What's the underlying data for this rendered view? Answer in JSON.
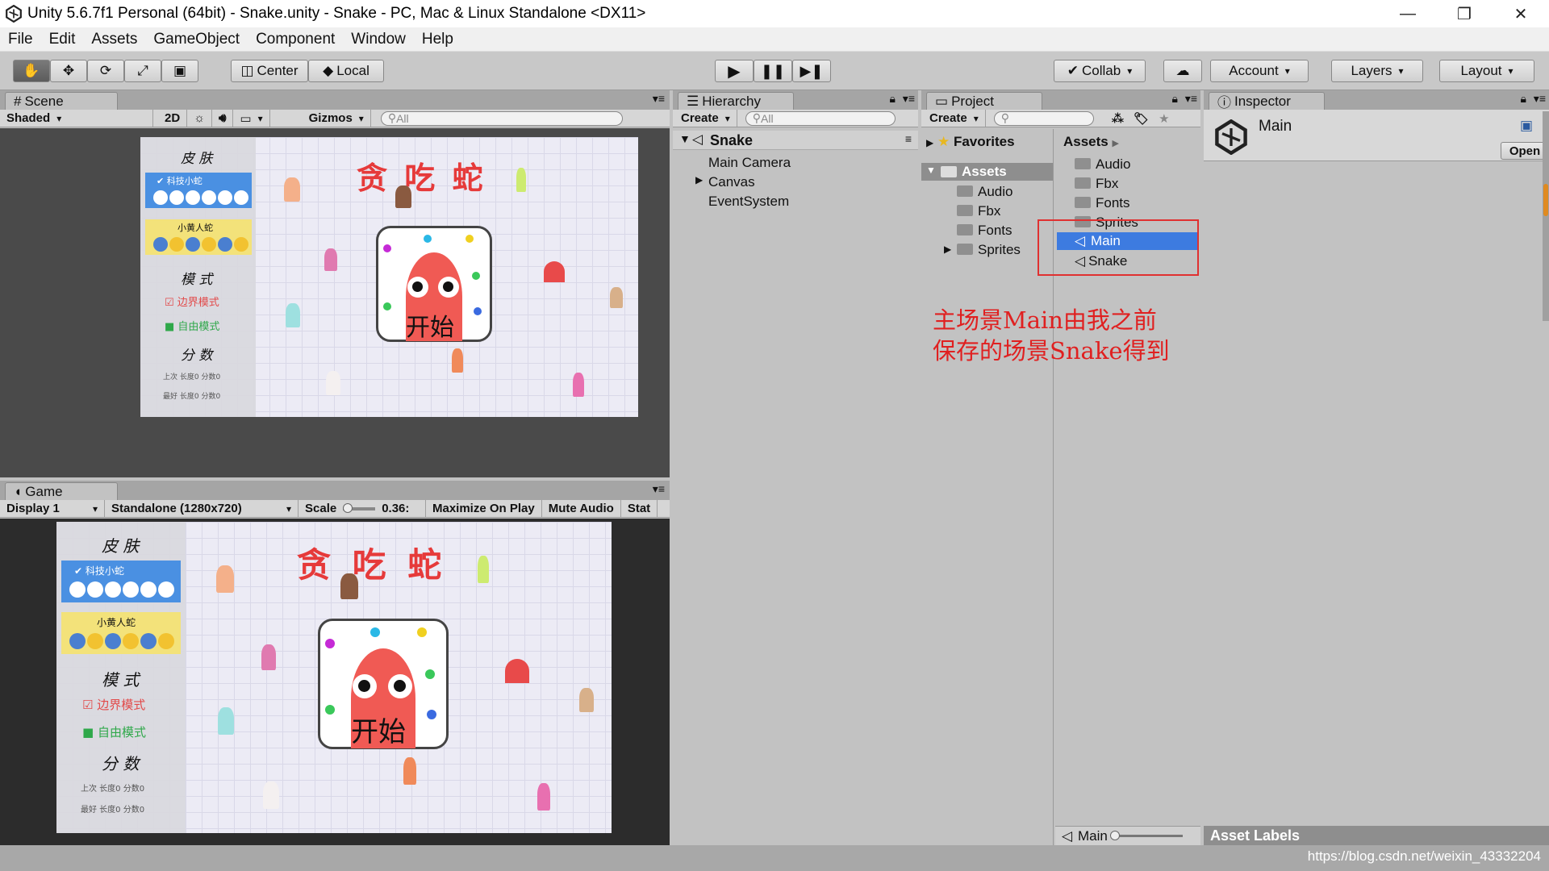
{
  "window": {
    "title": "Unity 5.6.7f1 Personal (64bit) - Snake.unity - Snake - PC, Mac & Linux Standalone <DX11>",
    "controls": [
      "—",
      "❐",
      "✕"
    ]
  },
  "menu": [
    "File",
    "Edit",
    "Assets",
    "GameObject",
    "Component",
    "Window",
    "Help"
  ],
  "toolbar": {
    "pivot": "Center",
    "space": "Local",
    "collab": "Collab",
    "account": "Account",
    "layers": "Layers",
    "layout": "Layout"
  },
  "scene": {
    "tab": "Scene",
    "shading": "Shaded",
    "mode2d": "2D",
    "gizmos": "Gizmos",
    "search_placeholder": "All"
  },
  "game": {
    "tab": "Game",
    "display": "Display 1",
    "resolution": "Standalone (1280x720)",
    "scale_label": "Scale",
    "scale_value": "0.36:",
    "maximize": "Maximize On Play",
    "mute": "Mute Audio",
    "stats": "Stat"
  },
  "game_ui": {
    "title": "贪 吃 蛇",
    "skin_header": "皮 肤",
    "skin1": "科技小蛇",
    "skin2": "小黄人蛇",
    "mode_header": "模 式",
    "mode1": "边界模式",
    "mode2": "自由模式",
    "score_header": "分 数",
    "score_row1": "上次  长度0  分数0",
    "score_row2": "最好  长度0  分数0",
    "start": "开始"
  },
  "hierarchy": {
    "tab": "Hierarchy",
    "create": "Create",
    "search_placeholder": "All",
    "scene_name": "Snake",
    "items": [
      "Main Camera",
      "Canvas",
      "EventSystem"
    ]
  },
  "project": {
    "tab": "Project",
    "create": "Create",
    "favorites": "Favorites",
    "assets": "Assets",
    "tree_children": [
      "Audio",
      "Fbx",
      "Fonts",
      "Sprites"
    ],
    "breadcrumb": "Assets",
    "assets_list": [
      "Audio",
      "Fbx",
      "Fonts",
      "Sprites",
      "Main",
      "Snake"
    ],
    "selected": "Main",
    "footer": "Main"
  },
  "inspector": {
    "tab": "Inspector",
    "object_name": "Main",
    "open": "Open",
    "asset_labels": "Asset Labels"
  },
  "annotation": {
    "line1": "主场景Main由我之前",
    "line2": "保存的场景Snake得到"
  },
  "watermark": "https://blog.csdn.net/weixin_43332204",
  "colors": {
    "selection": "#3d7be0",
    "highlight_box": "#e03030",
    "title_red": "#e63a3a",
    "ghost_red": "#f05a54"
  }
}
